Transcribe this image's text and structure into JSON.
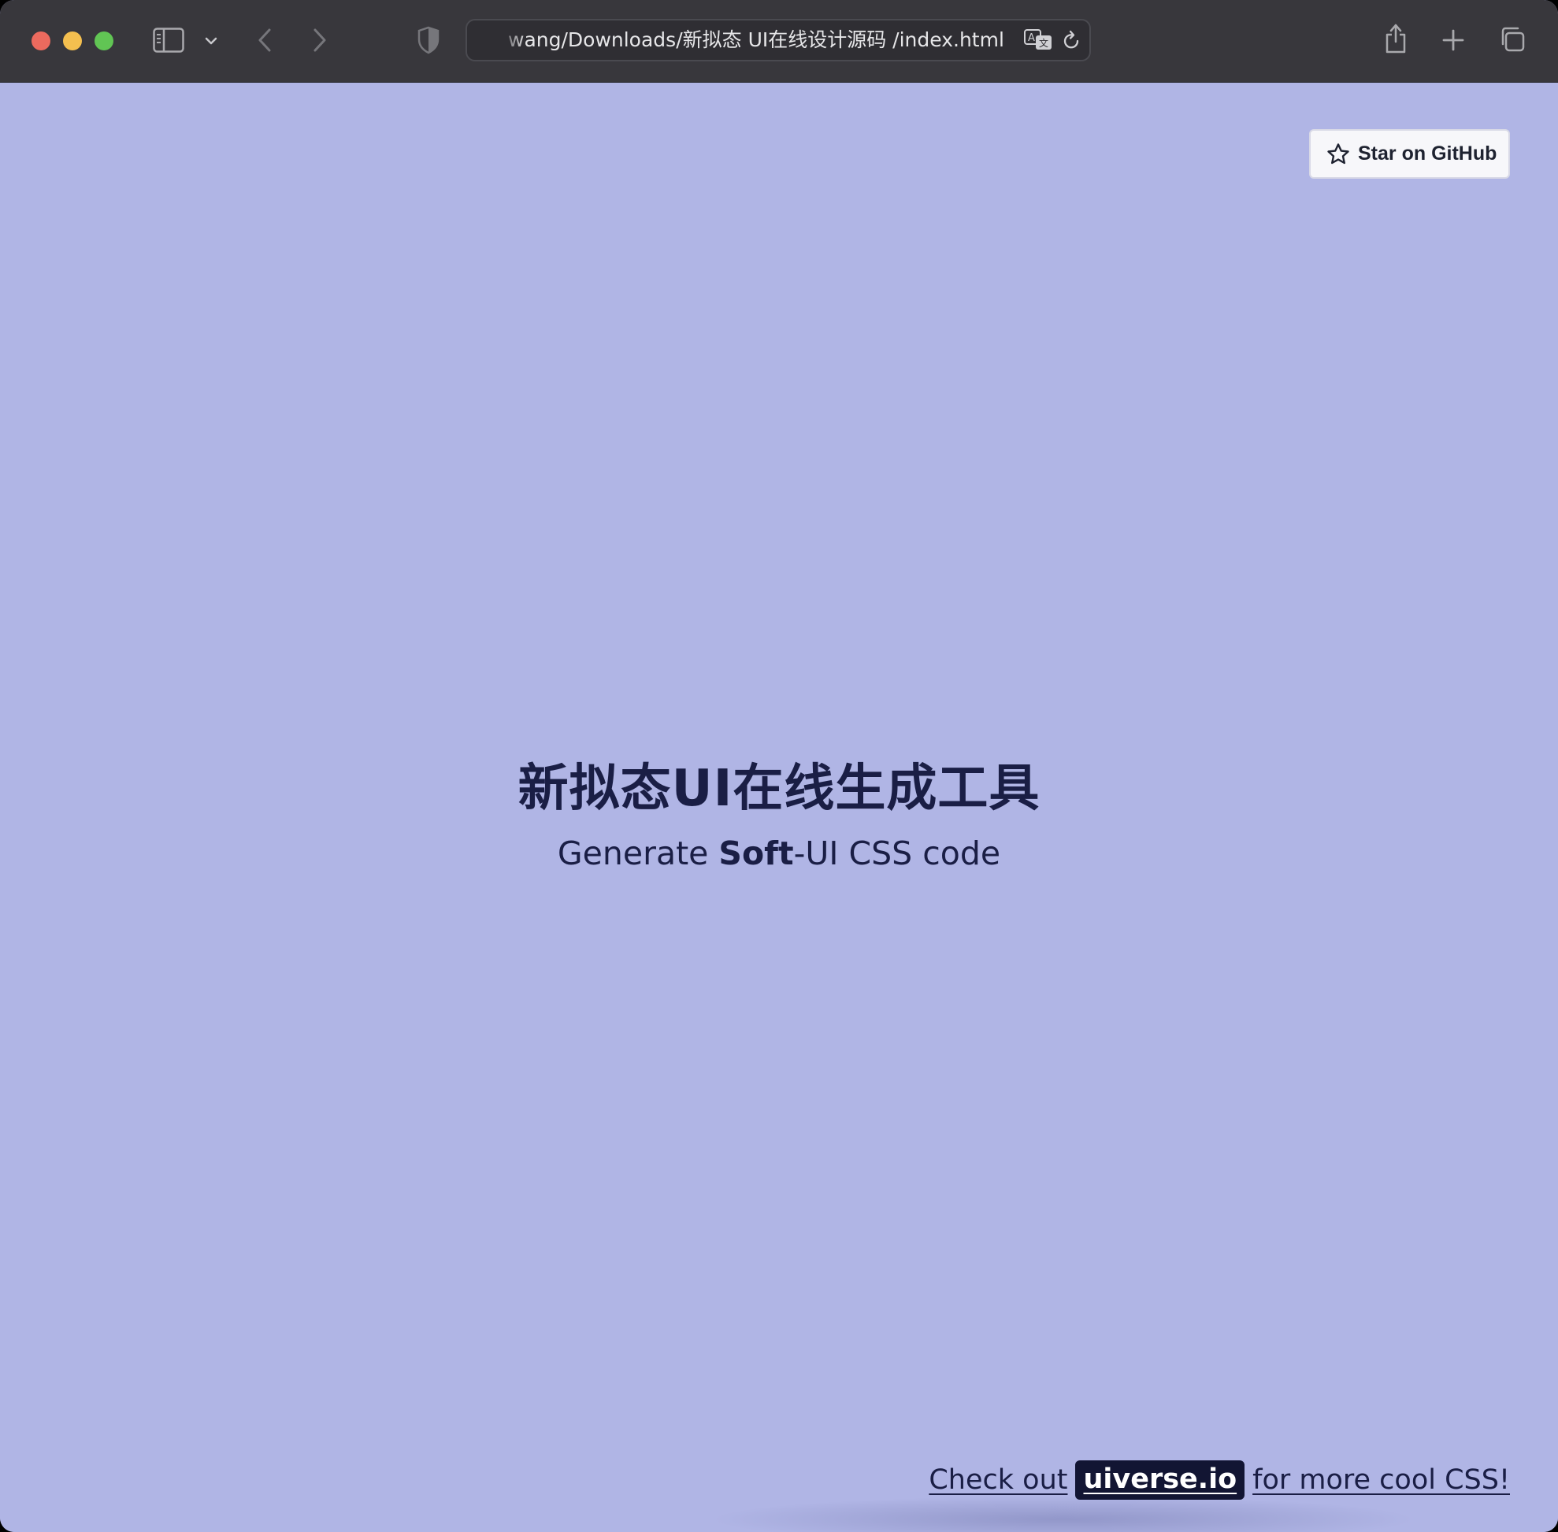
{
  "browser": {
    "address": "wang/Downloads/新拟态 UI在线设计源码 /index.html",
    "icons": {
      "sidebar": "sidebar-icon",
      "chevron": "chevron-down-icon",
      "back": "back-arrow-icon",
      "forward": "forward-arrow-icon",
      "shield": "shield-icon",
      "translate": "translate-icon",
      "reload": "reload-icon",
      "share": "share-icon",
      "new_tab": "plus-icon",
      "tabs": "tab-overview-icon"
    }
  },
  "page": {
    "background": "#b0b5e5",
    "github_button": {
      "label": "Star on GitHub",
      "icon": "star-icon"
    },
    "hero": {
      "title": "新拟态UI在线生成工具",
      "subtitle_prefix": "Generate ",
      "subtitle_bold": "Soft",
      "subtitle_suffix": "-UI CSS code"
    },
    "footer": {
      "prefix": "Check out",
      "badge": "uiverse.io",
      "suffix": "for more cool CSS!"
    }
  }
}
